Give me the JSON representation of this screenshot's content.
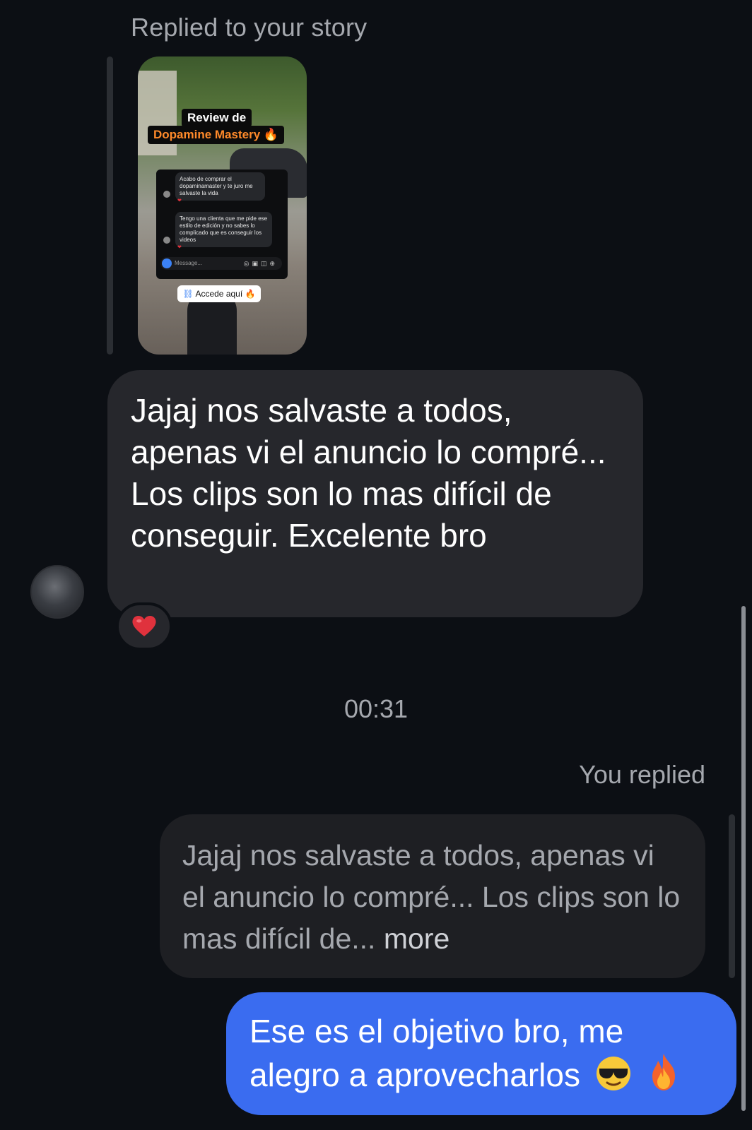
{
  "story_reply": {
    "header": "Replied to your story",
    "story": {
      "title_line1": "Review de",
      "title_line2": "Dopamine Mastery 🔥",
      "dm_message_1": "Acabo de comprar el dopaminamaster y te juro me salvaste la vida",
      "dm_message_2": "Tengo una clienta que me pide ese estilo de edición y no sabes lo complicado que es conseguir los videos",
      "compose_placeholder": "Message...",
      "link_label": "Accede aquí 🔥"
    }
  },
  "incoming_message": {
    "text": "Jajaj nos salvaste a todos, apenas vi el anuncio lo compré... Los clips son lo mas difícil de conseguir. Excelente bro",
    "reaction": "heart"
  },
  "timestamp": "00:31",
  "reply": {
    "label": "You replied",
    "quoted_text": "Jajaj nos salvaste a todos, apenas vi el anuncio lo compré... Los clips son lo mas difícil de...",
    "more_label": "more",
    "message_text": "Ese es el objetivo bro, me alegro a aprovecharlos",
    "emojis": [
      "sunglasses-emoji",
      "fire-emoji"
    ]
  },
  "colors": {
    "background": "#0c0f14",
    "incoming_bubble": "#26272c",
    "outgoing_bubble": "#3a6cf0",
    "muted_text": "#a5a8ae",
    "heart": "#e0323d"
  }
}
